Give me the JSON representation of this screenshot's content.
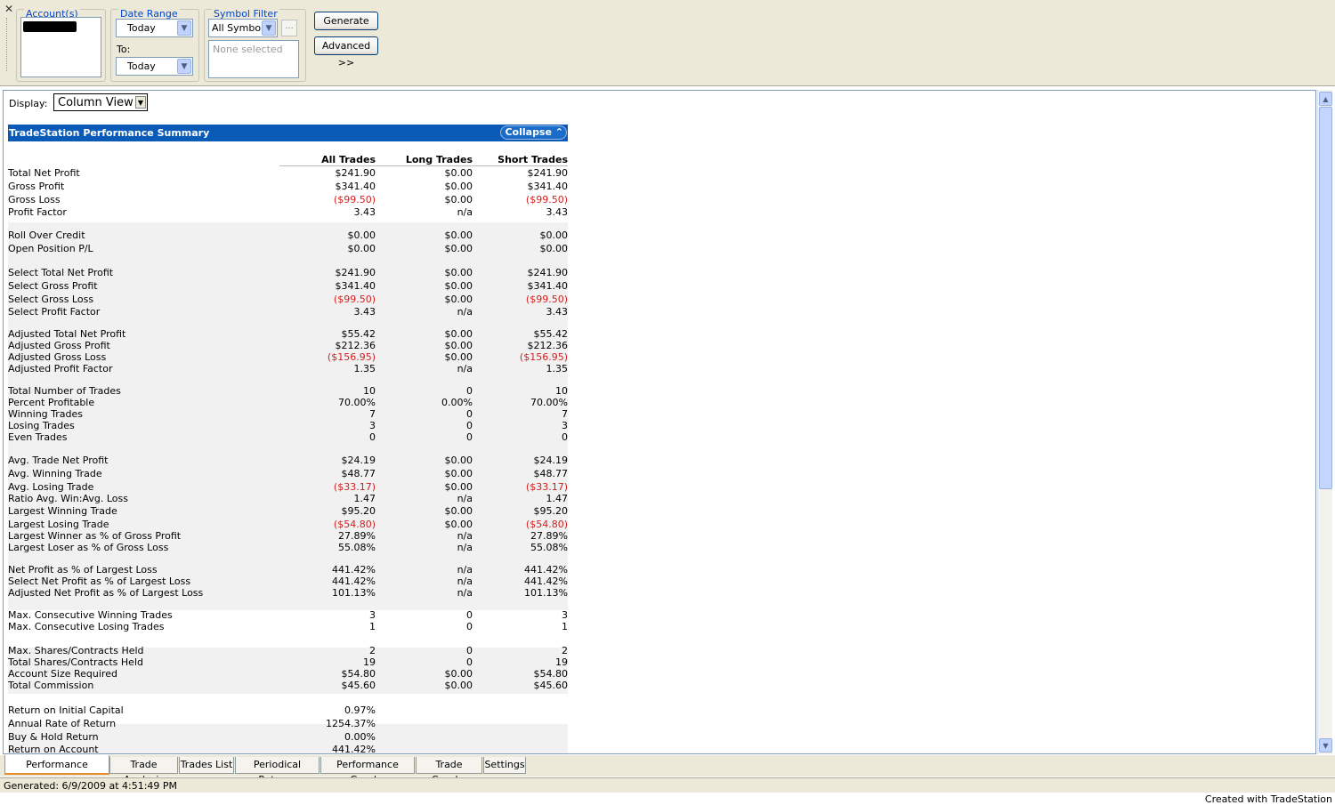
{
  "toolbar": {
    "accounts_label": "Account(s)",
    "date_range_label": "Date Range",
    "date_from": "Today",
    "to_label": "To:",
    "date_to": "Today",
    "symbol_filter_label": "Symbol Filter",
    "symbol_value": "All Symbols",
    "ellipsis": "...",
    "symbols_placeholder": "None selected",
    "generate_label": "Generate",
    "advanced_label": "Advanced >>"
  },
  "display": {
    "label": "Display:",
    "value": "Column View"
  },
  "report": {
    "title": "TradeStation Performance Summary",
    "collapse_label": "Collapse ⌃",
    "col_all": "All Trades",
    "col_long": "Long Trades",
    "col_short": "Short Trades",
    "rows": [
      {
        "label": "Total Net Profit",
        "all": "$241.90",
        "long": "$0.00",
        "short": "$241.90"
      },
      {
        "label": "Gross Profit",
        "all": "$341.40",
        "long": "$0.00",
        "short": "$341.40"
      },
      {
        "label": "Gross Loss",
        "all": "($99.50)",
        "long": "$0.00",
        "short": "($99.50)"
      },
      {
        "label": "Profit Factor",
        "all": "3.43",
        "long": "n/a",
        "short": "3.43"
      },
      {
        "label": "Roll Over Credit",
        "all": "$0.00",
        "long": "$0.00",
        "short": "$0.00"
      },
      {
        "label": "Open Position P/L",
        "all": "$0.00",
        "long": "$0.00",
        "short": "$0.00"
      },
      {
        "label": "Select Total Net Profit",
        "all": "$241.90",
        "long": "$0.00",
        "short": "$241.90"
      },
      {
        "label": "Select Gross Profit",
        "all": "$341.40",
        "long": "$0.00",
        "short": "$341.40"
      },
      {
        "label": "Select Gross Loss",
        "all": "($99.50)",
        "long": "$0.00",
        "short": "($99.50)"
      },
      {
        "label": "Select Profit Factor",
        "all": "3.43",
        "long": "n/a",
        "short": "3.43"
      },
      {
        "label": "Adjusted Total Net Profit",
        "all": "$55.42",
        "long": "$0.00",
        "short": "$55.42"
      },
      {
        "label": "Adjusted Gross Profit",
        "all": "$212.36",
        "long": "$0.00",
        "short": "$212.36"
      },
      {
        "label": "Adjusted Gross Loss",
        "all": "($156.95)",
        "long": "$0.00",
        "short": "($156.95)"
      },
      {
        "label": "Adjusted Profit Factor",
        "all": "1.35",
        "long": "n/a",
        "short": "1.35"
      },
      {
        "label": "Total Number of Trades",
        "all": "10",
        "long": "0",
        "short": "10"
      },
      {
        "label": "Percent Profitable",
        "all": "70.00%",
        "long": "0.00%",
        "short": "70.00%"
      },
      {
        "label": "Winning Trades",
        "all": "7",
        "long": "0",
        "short": "7"
      },
      {
        "label": "Losing Trades",
        "all": "3",
        "long": "0",
        "short": "3"
      },
      {
        "label": "Even Trades",
        "all": "0",
        "long": "0",
        "short": "0"
      },
      {
        "label": "Avg. Trade Net Profit",
        "all": "$24.19",
        "long": "$0.00",
        "short": "$24.19"
      },
      {
        "label": "Avg. Winning Trade",
        "all": "$48.77",
        "long": "$0.00",
        "short": "$48.77"
      },
      {
        "label": "Avg. Losing Trade",
        "all": "($33.17)",
        "long": "$0.00",
        "short": "($33.17)"
      },
      {
        "label": "Ratio Avg. Win:Avg. Loss",
        "all": "1.47",
        "long": "n/a",
        "short": "1.47"
      },
      {
        "label": "Largest Winning Trade",
        "all": "$95.20",
        "long": "$0.00",
        "short": "$95.20"
      },
      {
        "label": "Largest Losing Trade",
        "all": "($54.80)",
        "long": "$0.00",
        "short": "($54.80)"
      },
      {
        "label": "Largest Winner as % of Gross Profit",
        "all": "27.89%",
        "long": "n/a",
        "short": "27.89%"
      },
      {
        "label": "Largest Loser as % of Gross Loss",
        "all": "55.08%",
        "long": "n/a",
        "short": "55.08%"
      },
      {
        "label": "Net Profit as % of Largest Loss",
        "all": "441.42%",
        "long": "n/a",
        "short": "441.42%"
      },
      {
        "label": "Select Net Profit as % of Largest Loss",
        "all": "441.42%",
        "long": "n/a",
        "short": "441.42%"
      },
      {
        "label": "Adjusted Net Profit as % of Largest Loss",
        "all": "101.13%",
        "long": "n/a",
        "short": "101.13%"
      },
      {
        "label": "Max. Consecutive Winning Trades",
        "all": "3",
        "long": "0",
        "short": "3"
      },
      {
        "label": "Max. Consecutive Losing Trades",
        "all": "1",
        "long": "0",
        "short": "1"
      },
      {
        "label": "Max. Shares/Contracts Held",
        "all": "2",
        "long": "0",
        "short": "2"
      },
      {
        "label": "Total Shares/Contracts Held",
        "all": "19",
        "long": "0",
        "short": "19"
      },
      {
        "label": "Account Size Required",
        "all": "$54.80",
        "long": "$0.00",
        "short": "$54.80"
      },
      {
        "label": "Total Commission",
        "all": "$45.60",
        "long": "$0.00",
        "short": "$45.60"
      },
      {
        "label": "Return on Initial Capital",
        "all": "0.97%",
        "long": "",
        "short": ""
      },
      {
        "label": "Annual Rate of Return",
        "all": "1254.37%",
        "long": "",
        "short": ""
      },
      {
        "label": "Buy & Hold Return",
        "all": "0.00%",
        "long": "",
        "short": ""
      },
      {
        "label": "Return on Account",
        "all": "441.42%",
        "long": "",
        "short": ""
      }
    ]
  },
  "tabs": [
    {
      "label": "Performance Summary",
      "active": true
    },
    {
      "label": "Trade Analysis",
      "active": false
    },
    {
      "label": "Trades List",
      "active": false
    },
    {
      "label": "Periodical Returns",
      "active": false
    },
    {
      "label": "Performance Graphs",
      "active": false
    },
    {
      "label": "Trade Graphs",
      "active": false
    },
    {
      "label": "Settings",
      "active": false
    }
  ],
  "status": {
    "generated": "Generated: 6/9/2009 at 4:51:49 PM",
    "created_with": "Created with TradeStation"
  },
  "icons": {
    "close": "close-icon",
    "dropdown": "chevron-down-icon",
    "scroll_up": "arrow-up-icon",
    "scroll_down": "arrow-down-icon"
  },
  "colors": {
    "header_bar": "#0a5ab8",
    "negative": "#d42020",
    "active_tab_accent": "#e68b2c"
  }
}
